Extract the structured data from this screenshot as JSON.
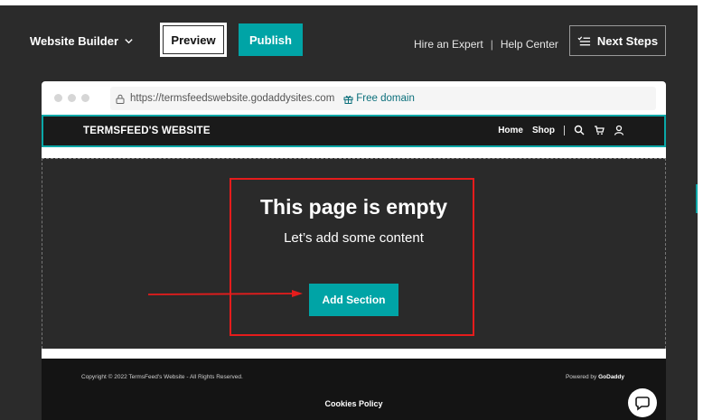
{
  "toolbar": {
    "brand_label": "Website Builder",
    "preview_label": "Preview",
    "publish_label": "Publish",
    "hire_expert_label": "Hire an Expert",
    "separator": "|",
    "help_center_label": "Help Center",
    "next_steps_label": "Next Steps"
  },
  "browser": {
    "url": "https://termsfeedswebsite.godaddysites.com",
    "free_domain_label": "Free domain"
  },
  "site": {
    "title": "TERMSFEED'S WEBSITE",
    "nav": {
      "home": "Home",
      "shop": "Shop",
      "separator": "|"
    }
  },
  "empty_state": {
    "title": "This page is empty",
    "subtitle": "Let’s add some content",
    "add_section_label": "Add Section"
  },
  "footer": {
    "copyright": "Copyright © 2022 TermsFeed's Website - All Rights Reserved.",
    "powered_by_prefix": "Powered by",
    "powered_by_brand": "GoDaddy",
    "cookies_policy": "Cookies Policy"
  },
  "colors": {
    "accent": "#00a4a6",
    "annotation_red": "#e51c1c",
    "editor_bg": "#2b2b2b"
  },
  "icons": [
    "chevron-down-icon",
    "next-steps-list-icon",
    "lock-icon",
    "gift-icon",
    "search-icon",
    "cart-icon",
    "user-icon",
    "chat-icon"
  ]
}
